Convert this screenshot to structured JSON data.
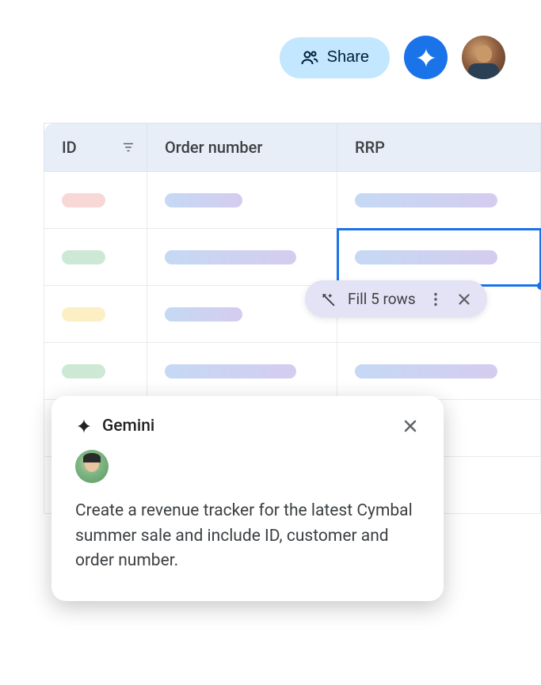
{
  "topbar": {
    "share_label": "Share"
  },
  "table": {
    "headers": {
      "id": "ID",
      "order": "Order number",
      "rrp": "RRP"
    }
  },
  "fill_pill": {
    "label": "Fill 5 rows"
  },
  "gemini": {
    "title": "Gemini",
    "prompt": "Create a revenue tracker for the latest Cymbal summer sale and include ID, customer and order number."
  }
}
